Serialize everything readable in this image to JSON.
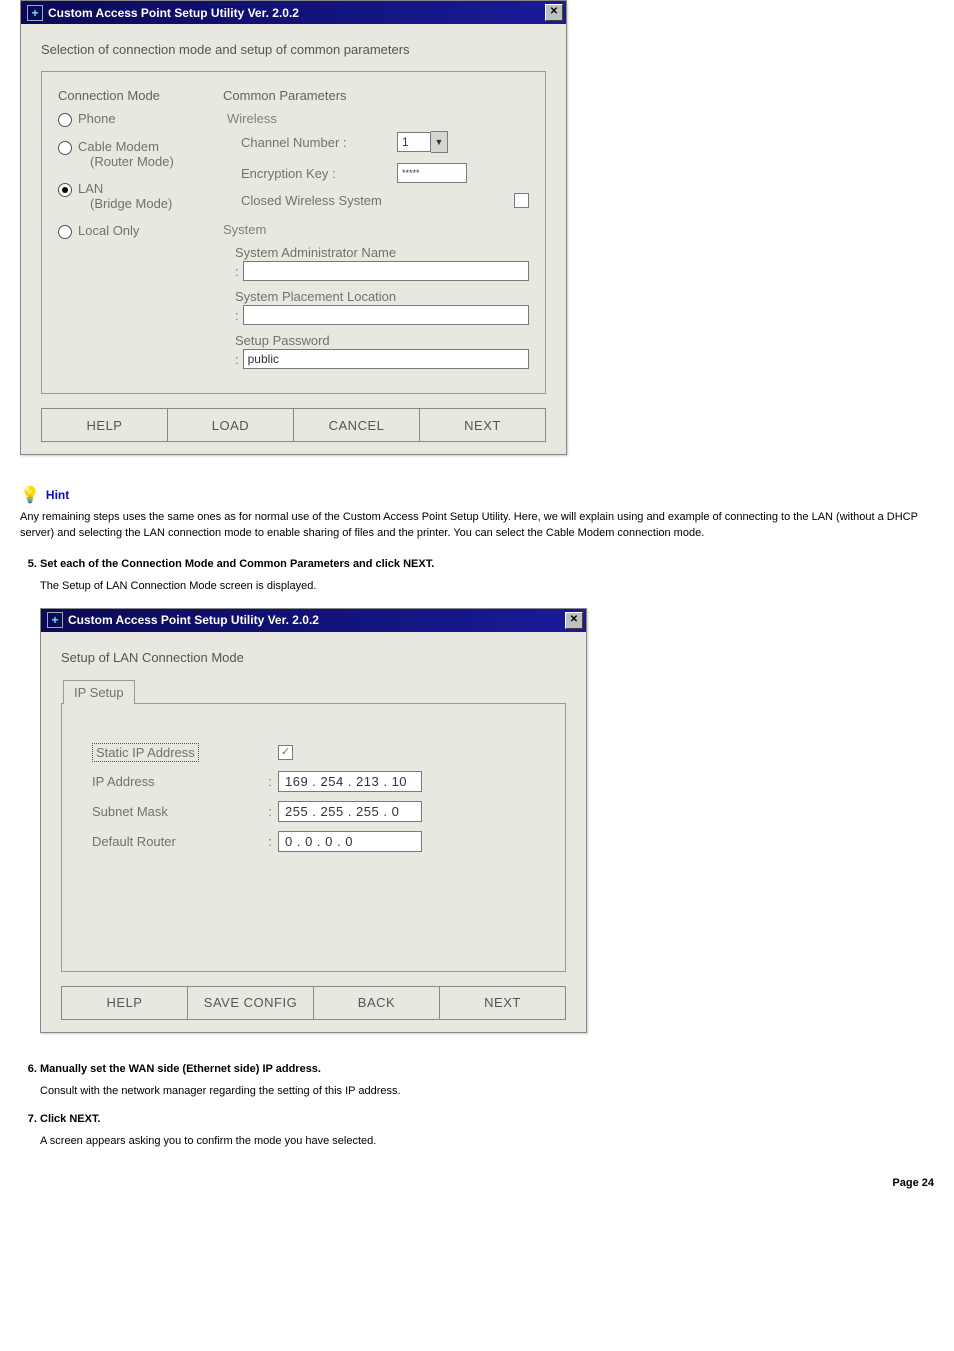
{
  "dialog1": {
    "title": "Custom Access Point Setup Utility  Ver. 2.0.2",
    "intro": "Selection of connection mode and setup of common parameters",
    "connection_mode_head": "Connection Mode",
    "radios": {
      "phone": "Phone",
      "cable": "Cable Modem",
      "cable_sub": "(Router Mode)",
      "lan": "LAN",
      "lan_sub": "(Bridge Mode)",
      "local": "Local Only"
    },
    "common_head": "Common Parameters",
    "wireless_head": "Wireless",
    "channel_label": "Channel Number   :",
    "channel_value": "1",
    "enc_label": "Encryption Key       :",
    "enc_value": "*****",
    "closed_label": "Closed Wireless System",
    "system_head": "System",
    "sysadmin_label": "System Administrator Name",
    "sysadmin_value": "",
    "placement_label": "System Placement Location",
    "placement_value": "",
    "setup_pw_label": "Setup Password",
    "setup_pw_value": "public",
    "buttons": {
      "help": "HELP",
      "load": "LOAD",
      "cancel": "CANCEL",
      "next": "NEXT"
    }
  },
  "hint": {
    "label": "Hint",
    "text": "Any remaining steps uses the same ones as for normal use of the Custom Access Point Setup Utility. Here, we will explain using and example of connecting to the LAN (without a DHCP server) and selecting the LAN connection mode to enable sharing of files and the printer. You can select the Cable Modem connection mode."
  },
  "step5": {
    "num": "5.",
    "title": "Set each of the Connection Mode and Common Parameters and click NEXT.",
    "sub": "The Setup of LAN Connection Mode screen is displayed."
  },
  "dialog2": {
    "title": "Custom Access Point Setup Utility  Ver. 2.0.2",
    "intro": "Setup of LAN Connection Mode",
    "tab": "IP Setup",
    "static_label": "Static IP Address",
    "static_checked": true,
    "ip_label": "IP Address",
    "ip_value": "169 . 254 . 213 .  10",
    "subnet_label": "Subnet Mask",
    "subnet_value": "255 . 255 . 255 .   0",
    "router_label": "Default Router",
    "router_value": "  0  .   0  .   0  .   0",
    "buttons": {
      "help": "HELP",
      "save": "SAVE CONFIG",
      "back": "BACK",
      "next": "NEXT"
    }
  },
  "step6": {
    "num": "6.",
    "title": "Manually set the WAN side (Ethernet side) IP address.",
    "sub": "Consult with the network manager regarding the setting of this IP address."
  },
  "step7": {
    "num": "7.",
    "title": "Click NEXT.",
    "sub": "A screen appears asking you to confirm the mode you have selected."
  },
  "page_num": "Page 24"
}
